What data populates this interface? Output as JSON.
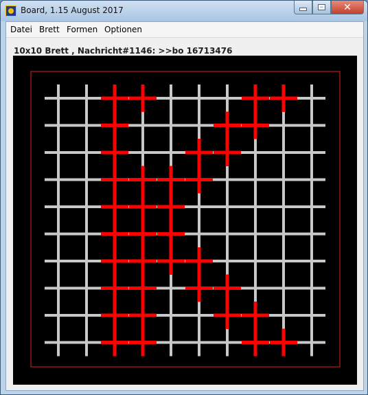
{
  "window": {
    "title": "Board, 1.15 August 2017"
  },
  "menu": [
    {
      "label": "Datei"
    },
    {
      "label": "Brett"
    },
    {
      "label": "Formen"
    },
    {
      "label": "Optionen"
    }
  ],
  "status_text": "10x10 Brett , Nachricht#1146: >>bo 16713476",
  "board": {
    "rows": 10,
    "cols": 10,
    "grid_color": "#c8c8c8",
    "highlight_color": "#ff0000",
    "background_color": "#000000",
    "border_color": "#e02020",
    "highlighted_cells": [
      [
        0,
        2
      ],
      [
        0,
        3
      ],
      [
        0,
        7
      ],
      [
        0,
        8
      ],
      [
        1,
        2
      ],
      [
        1,
        6
      ],
      [
        1,
        7
      ],
      [
        2,
        2
      ],
      [
        2,
        5
      ],
      [
        2,
        6
      ],
      [
        3,
        2
      ],
      [
        3,
        3
      ],
      [
        3,
        4
      ],
      [
        3,
        5
      ],
      [
        4,
        2
      ],
      [
        4,
        3
      ],
      [
        4,
        4
      ],
      [
        5,
        2
      ],
      [
        5,
        3
      ],
      [
        5,
        4
      ],
      [
        6,
        2
      ],
      [
        6,
        3
      ],
      [
        6,
        4
      ],
      [
        6,
        5
      ],
      [
        7,
        2
      ],
      [
        7,
        3
      ],
      [
        7,
        5
      ],
      [
        7,
        6
      ],
      [
        8,
        2
      ],
      [
        8,
        3
      ],
      [
        8,
        6
      ],
      [
        8,
        7
      ],
      [
        9,
        2
      ],
      [
        9,
        3
      ],
      [
        9,
        7
      ],
      [
        9,
        8
      ]
    ]
  }
}
